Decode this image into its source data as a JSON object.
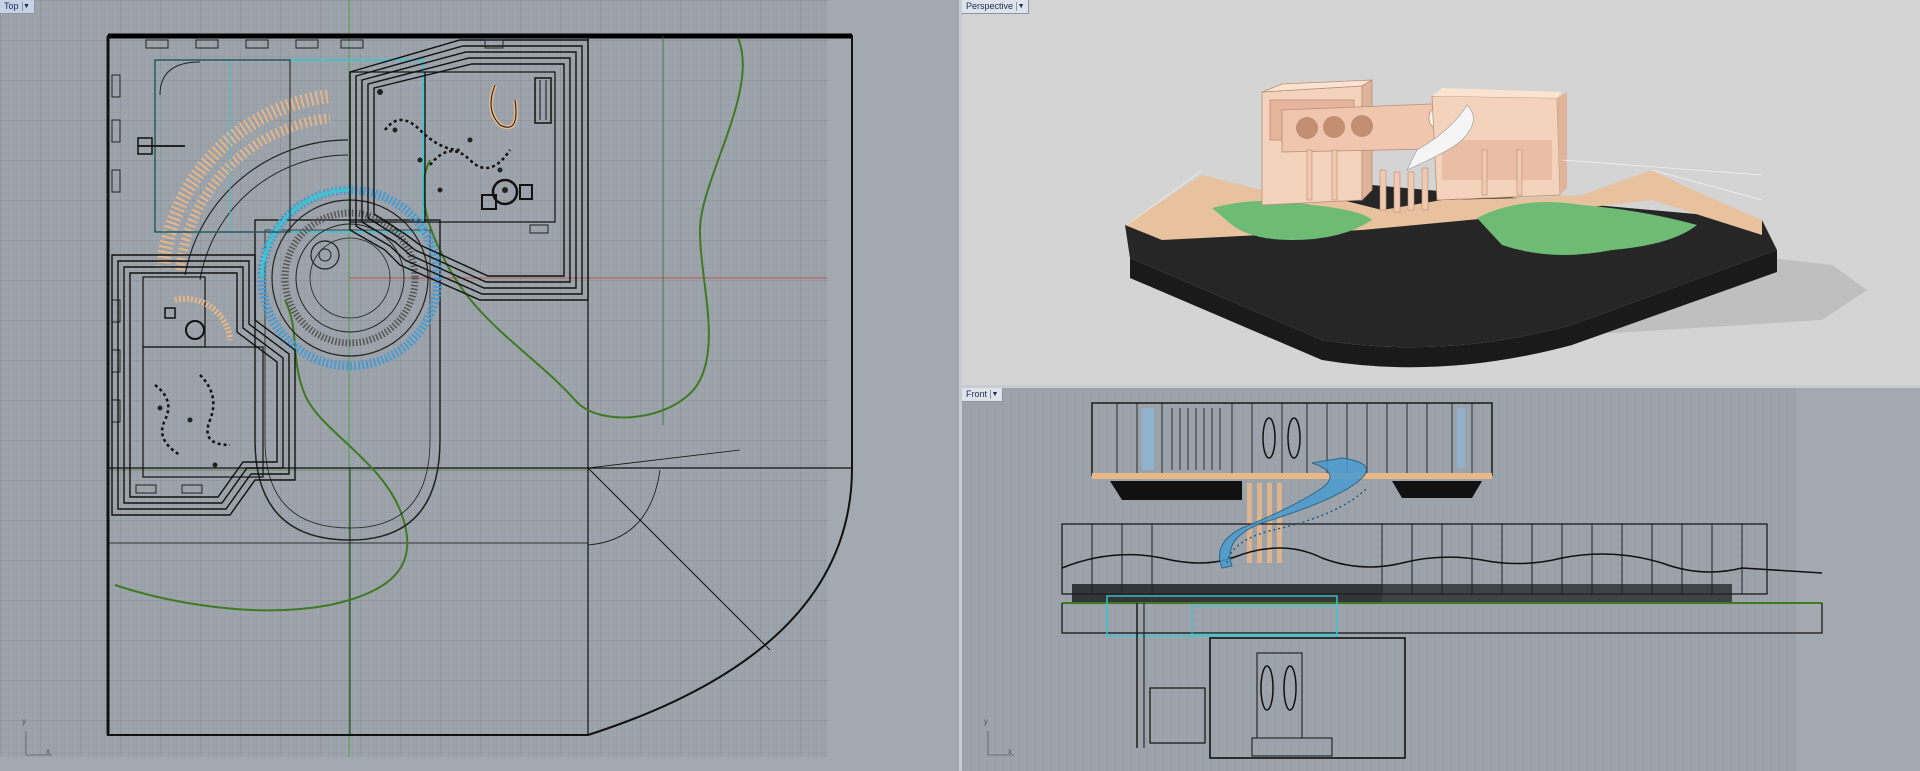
{
  "viewports": {
    "top": {
      "label": "Top",
      "dropdown_icon": "chevron-down-icon"
    },
    "perspective": {
      "label": "Perspective",
      "dropdown_icon": "chevron-down-icon"
    },
    "front": {
      "label": "Front",
      "dropdown_icon": "chevron-down-icon"
    }
  },
  "axis_labels": {
    "y": "y",
    "x": "x"
  },
  "colors": {
    "grid": "#8f959d",
    "grid_major": "#81878f",
    "curve_dark": "#1e1e1e",
    "cyan": "#37c6d2",
    "blue_stair": "#4a9bd0",
    "green_curve": "#3e7a22",
    "tan": "#e9b888",
    "model_pink": "#f0cbb3",
    "model_green": "#6dbb75",
    "model_base": "#262626"
  }
}
